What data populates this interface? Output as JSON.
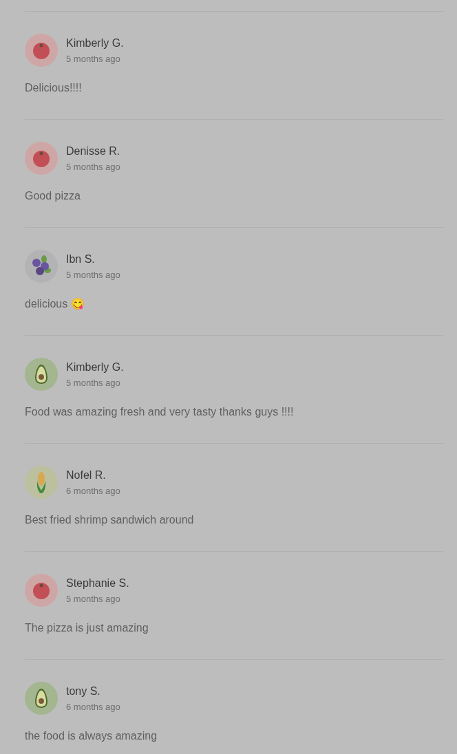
{
  "reviews": [
    {
      "name": "Kimberly G.",
      "time": "5 months ago",
      "text": "Delicious!!!!",
      "kind": "tomato"
    },
    {
      "name": "Denisse R.",
      "time": "5 months ago",
      "text": "Good pizza",
      "kind": "tomato"
    },
    {
      "name": "Ibn S.",
      "time": "5 months ago",
      "text": "delicious 😋",
      "kind": "berries"
    },
    {
      "name": "Kimberly G.",
      "time": "5 months ago",
      "text": "Food was amazing fresh and very tasty thanks guys !!!!",
      "kind": "avocado"
    },
    {
      "name": "Nofel R.",
      "time": "6 months ago",
      "text": "Best fried shrimp sandwich around",
      "kind": "corn"
    },
    {
      "name": "Stephanie S.",
      "time": "5 months ago",
      "text": "The pizza is just amazing",
      "kind": "tomato"
    },
    {
      "name": "tony S.",
      "time": "6 months ago",
      "text": "the food is always amazing",
      "kind": "avocado"
    }
  ]
}
